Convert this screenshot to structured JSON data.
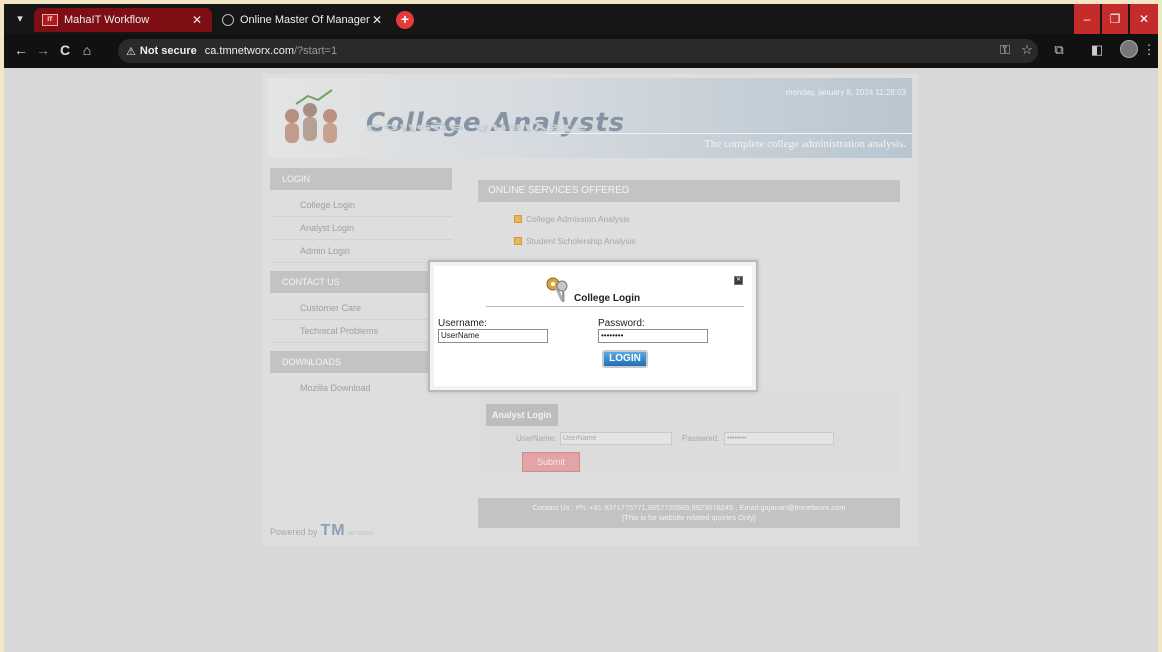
{
  "browser": {
    "tabs": [
      {
        "title": "MahaIT Workflow",
        "active": true
      },
      {
        "title": "Online Master Of Management",
        "active": false
      }
    ],
    "omnibox": {
      "security_label": "Not secure",
      "url_host": "ca.tmnetworx.com",
      "url_path": "/?start=1"
    },
    "icons": {
      "tab_menu": "▾",
      "tab_close": "✕",
      "new_tab": "+",
      "back": "←",
      "forward": "→",
      "reload": "C",
      "home": "⌂",
      "warning": "⚠",
      "key": "⚿",
      "star": "☆",
      "extensions": "⧉",
      "sidepanel": "◧",
      "menu": "⋮",
      "minimize": "–",
      "maximize": "❐",
      "close": "✕"
    }
  },
  "site": {
    "logo_text": "College Analysts",
    "datetime": "monday, january 8, 2024 11:28:03",
    "tagline": "The complete college administration analysis.",
    "sidebar": [
      {
        "heading": "LOGIN",
        "items": [
          "College Login",
          "Analyst Login",
          "Admin Login"
        ]
      },
      {
        "heading": "CONTACT US",
        "items": [
          "Customer Care",
          "Technical Problems"
        ]
      },
      {
        "heading": "DOWNLOADS",
        "items": [
          "Mozilla Download"
        ]
      }
    ],
    "services": {
      "heading": "ONLINE  SERVICES  OFFERED",
      "items": [
        "College Admission Analysis",
        "Student Scholership Analysis"
      ]
    },
    "analyst_login": {
      "heading": "Analyst Login",
      "username_label": "UserName",
      "username_value": "UserName",
      "password_label": "Password",
      "password_value": "••••••••",
      "submit_label": "Submit"
    },
    "footer": {
      "line1": "Contact Us : Ph: +91 9371775771,9657720589,9923078245 , Email:gajanan@tmnetworx.com",
      "line2": "[This is for website related quories Only]"
    },
    "powered_by": {
      "label": "Powered by",
      "brand": "TM",
      "brand_sub": "NETWORX"
    }
  },
  "modal": {
    "title": "College Login",
    "username_label": "Username:",
    "username_value": "UserName",
    "password_label": "Password:",
    "password_value": "••••••••",
    "login_label": "LOGIN",
    "close_icon": "✕"
  }
}
